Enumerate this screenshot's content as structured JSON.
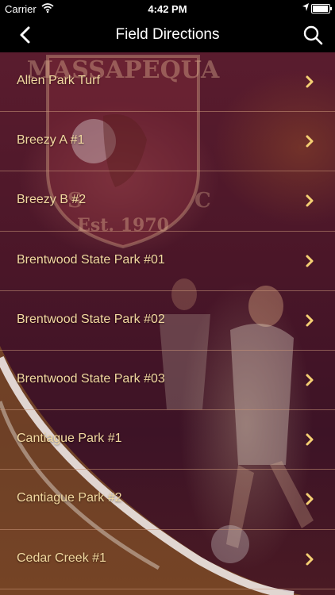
{
  "status_bar": {
    "carrier": "Carrier",
    "time": "4:42 PM",
    "battery_level": 0.95
  },
  "nav": {
    "title": "Field Directions",
    "back_icon": "chevron-left-icon",
    "search_icon": "search-icon"
  },
  "background": {
    "crest_text_top": "MASSAPEQUA",
    "crest_text_bottom": "Est. 1970",
    "letters": [
      "S",
      "C"
    ]
  },
  "colors": {
    "accent": "#f2d9a0",
    "bar": "#000000",
    "bg": "#4a1628",
    "chevron": "#f4cf73"
  },
  "items": [
    {
      "label": "Allen Park Turf"
    },
    {
      "label": "Breezy A #1"
    },
    {
      "label": "Breezy B #2"
    },
    {
      "label": "Brentwood State Park #01"
    },
    {
      "label": "Brentwood State Park #02"
    },
    {
      "label": "Brentwood State Park #03"
    },
    {
      "label": "Cantiague Park #1"
    },
    {
      "label": "Cantiague Park #2"
    },
    {
      "label": "Cedar Creek #1"
    }
  ]
}
